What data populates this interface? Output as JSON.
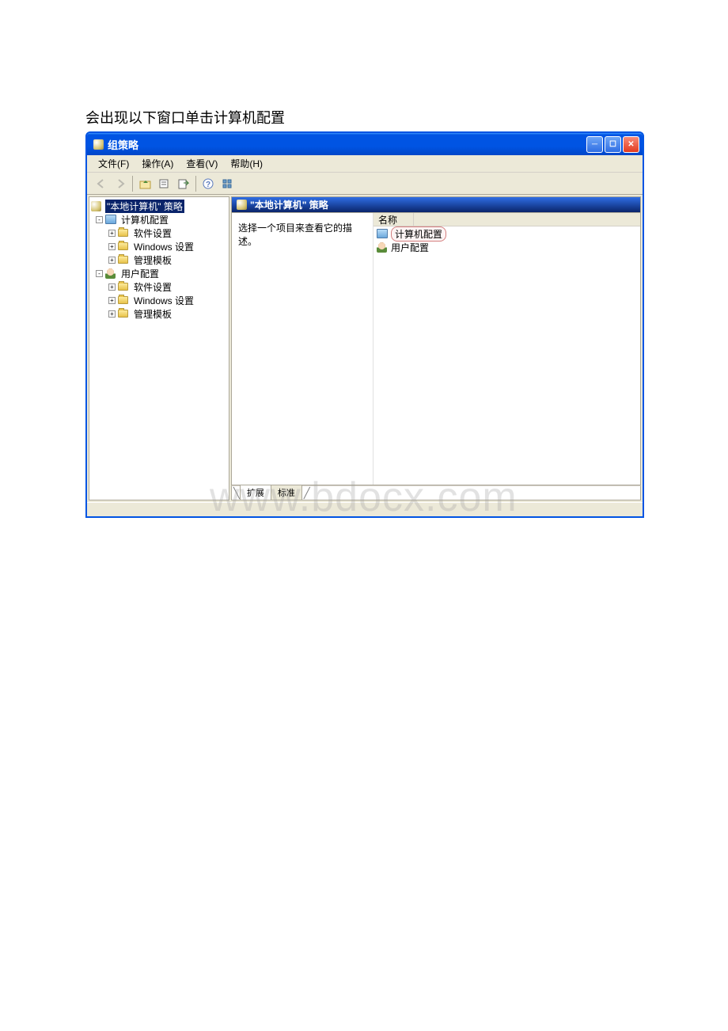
{
  "caption": "会出现以下窗口单击计算机配置",
  "window": {
    "title": "组策略"
  },
  "menubar": {
    "file": "文件(F)",
    "action": "操作(A)",
    "view": "查看(V)",
    "help": "帮助(H)"
  },
  "tree": {
    "root": "\"本地计算机\" 策略",
    "computer_config": "计算机配置",
    "software_settings": "软件设置",
    "windows_settings": "Windows 设置",
    "admin_templates": "管理模板",
    "user_config": "用户配置"
  },
  "right": {
    "header": "\"本地计算机\" 策略",
    "description": "选择一个项目来查看它的描述。",
    "column_name": "名称",
    "items": {
      "computer_config": "计算机配置",
      "user_config": "用户配置"
    }
  },
  "tabs": {
    "extended": "扩展",
    "standard": "标准"
  },
  "watermark": "www.bdocx.com"
}
